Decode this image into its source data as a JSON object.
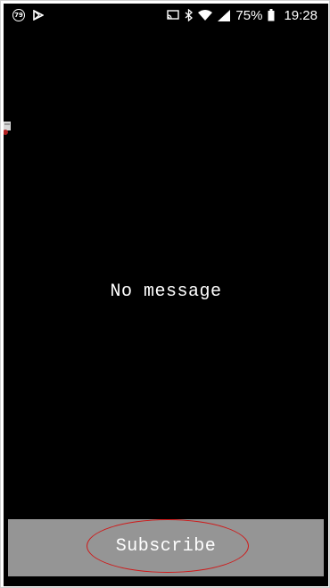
{
  "status_bar": {
    "notification_badge": "79",
    "battery_percent": "75%",
    "time": "19:28",
    "icons": [
      "notification-count-icon",
      "play-store-icon",
      "cast-icon",
      "bluetooth-icon",
      "wifi-icon",
      "signal-icon",
      "battery-icon"
    ]
  },
  "main": {
    "empty_message": "No message"
  },
  "subscribe": {
    "label": "Subscribe"
  },
  "colors": {
    "background": "#000000",
    "button": "#959595",
    "highlight": "#d01818",
    "text": "#ffffff"
  }
}
